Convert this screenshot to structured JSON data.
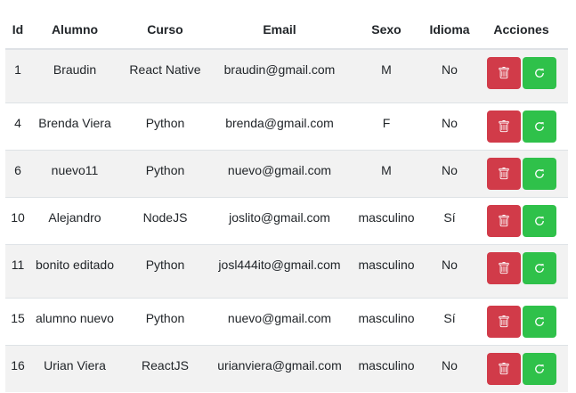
{
  "table": {
    "headers": [
      "Id",
      "Alumno",
      "Curso",
      "Email",
      "Sexo",
      "Idioma",
      "Acciones"
    ],
    "rows": [
      {
        "id": "1",
        "alumno": "Braudin",
        "curso": "React Native",
        "email": "braudin@gmail.com",
        "sexo": "M",
        "idioma": "No"
      },
      {
        "id": "4",
        "alumno": "Brenda Viera",
        "curso": "Python",
        "email": "brenda@gmail.com",
        "sexo": "F",
        "idioma": "No"
      },
      {
        "id": "6",
        "alumno": "nuevo11",
        "curso": "Python",
        "email": "nuevo@gmail.com",
        "sexo": "M",
        "idioma": "No"
      },
      {
        "id": "10",
        "alumno": "Alejandro",
        "curso": "NodeJS",
        "email": "joslito@gmail.com",
        "sexo": "masculino",
        "idioma": "Sí"
      },
      {
        "id": "11",
        "alumno": "bonito editado",
        "curso": "Python",
        "email": "josl444ito@gmail.com",
        "sexo": "masculino",
        "idioma": "No"
      },
      {
        "id": "15",
        "alumno": "alumno nuevo",
        "curso": "Python",
        "email": "nuevo@gmail.com",
        "sexo": "masculino",
        "idioma": "Sí"
      },
      {
        "id": "16",
        "alumno": "Urian Viera",
        "curso": "ReactJS",
        "email": "urianviera@gmail.com",
        "sexo": "masculino",
        "idioma": "No"
      }
    ]
  },
  "actions": {
    "delete_icon": "trash-icon",
    "update_icon": "refresh-icon"
  },
  "colors": {
    "danger": "#d13b49",
    "success": "#2fc14a",
    "stripe": "#f2f2f2"
  }
}
